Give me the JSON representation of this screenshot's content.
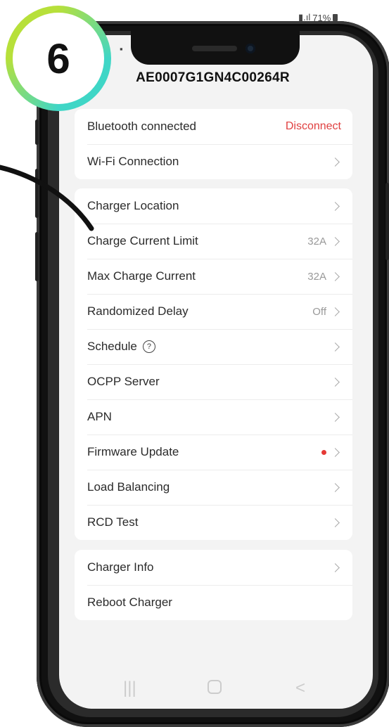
{
  "badge": {
    "number": "6"
  },
  "status": {
    "battery": "71%"
  },
  "header": {
    "title": "AE0007G1GN4C00264R"
  },
  "connection": {
    "bluetooth_label": "Bluetooth connected",
    "disconnect_label": "Disconnect",
    "wifi_label": "Wi-Fi Connection"
  },
  "settings": [
    {
      "label": "Charger Location",
      "value": ""
    },
    {
      "label": "Charge Current Limit",
      "value": "32A"
    },
    {
      "label": "Max Charge Current",
      "value": "32A"
    },
    {
      "label": "Randomized Delay",
      "value": "Off"
    },
    {
      "label": "Schedule",
      "value": ""
    },
    {
      "label": "OCPP Server",
      "value": ""
    },
    {
      "label": "APN",
      "value": ""
    },
    {
      "label": "Firmware Update",
      "value": ""
    },
    {
      "label": "Load Balancing",
      "value": ""
    },
    {
      "label": "RCD Test",
      "value": ""
    }
  ],
  "info": {
    "charger_info_label": "Charger Info",
    "reboot_label": "Reboot Charger"
  },
  "colors": {
    "accent_red": "#e04040",
    "badge_green": "#b7e03a",
    "badge_teal": "#3fd6c6"
  },
  "icons": {
    "nav_recent": "recent-apps-icon",
    "nav_home": "home-icon",
    "nav_back": "back-icon"
  }
}
